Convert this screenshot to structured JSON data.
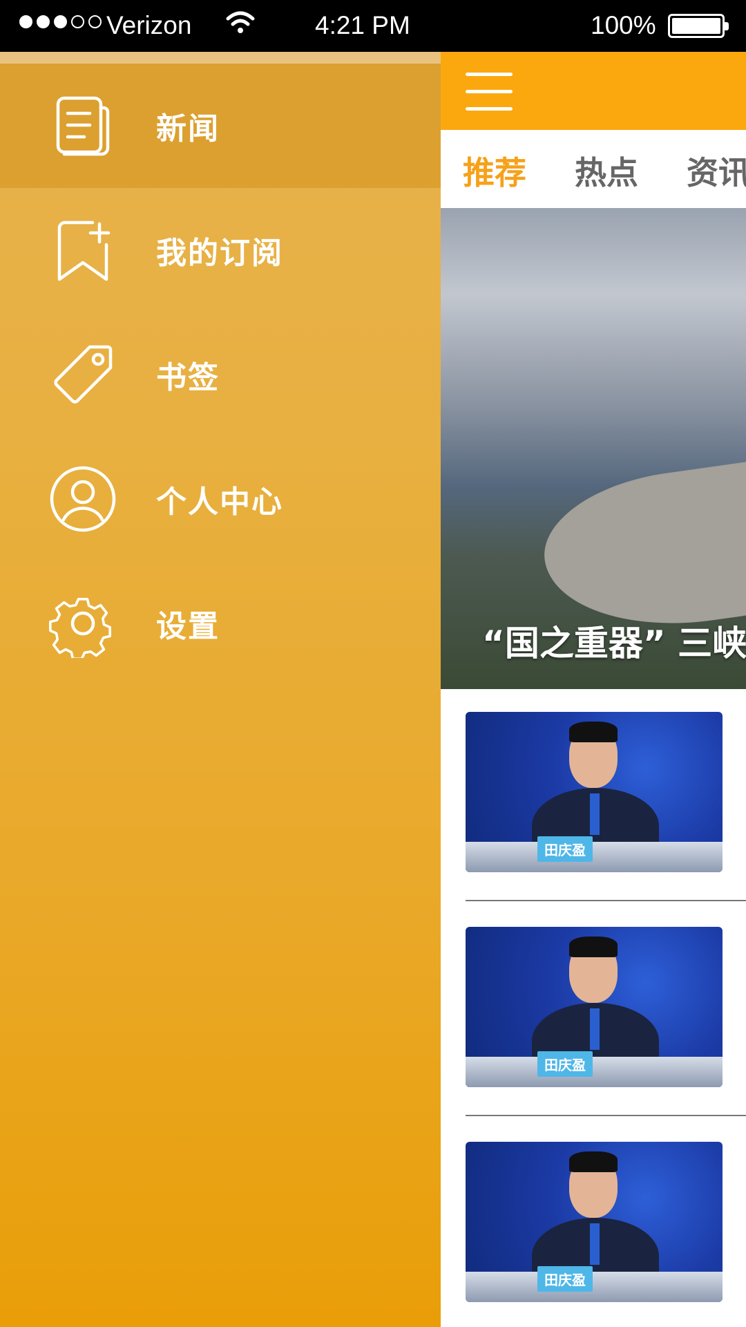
{
  "status_bar": {
    "carrier": "Verizon",
    "time": "4:21 PM",
    "battery": "100%"
  },
  "drawer": {
    "items": [
      {
        "label": "新闻",
        "icon": "newspaper-icon",
        "active": true
      },
      {
        "label": "我的订阅",
        "icon": "bookmark-add-icon",
        "active": false
      },
      {
        "label": "书签",
        "icon": "tag-icon",
        "active": false
      },
      {
        "label": "个人中心",
        "icon": "user-circle-icon",
        "active": false
      },
      {
        "label": "设置",
        "icon": "gear-icon",
        "active": false
      }
    ]
  },
  "main": {
    "tabs": [
      "推荐",
      "热点",
      "资讯"
    ],
    "hero_caption": "“国之重器” 三峡",
    "news": [
      {
        "nameplate": "田庆盈"
      },
      {
        "nameplate": "田庆盈"
      },
      {
        "nameplate": "田庆盈"
      }
    ]
  },
  "colors": {
    "accent": "#fba80f",
    "tab_active": "#f6a11a",
    "drawer_active": "#dca030"
  }
}
